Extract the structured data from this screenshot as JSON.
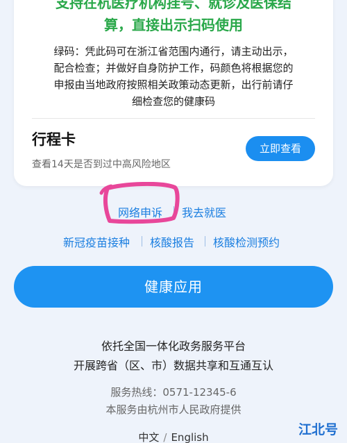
{
  "card": {
    "notice_line1": "支持在杭医疗机构挂号、就诊及医保结",
    "notice_line2": "算，直接出示扫码使用",
    "desc_lines": [
      "绿码：凭此码可在浙江省范围内通行，请主动出示，",
      "配合检查；并做好自身防护工作，码颜色将根据您的",
      "申报由当地政府按照相关政策动态更新，出行前请仔",
      "细检查您的健康码"
    ],
    "trip_title": "行程卡",
    "trip_subtitle": "查看14天是否到过中高风险地区",
    "trip_button": "立即查看"
  },
  "links_row1": {
    "appeal": "网络申诉",
    "see_doctor": "我去就医"
  },
  "links_row2": {
    "vaccine": "新冠疫苗接种",
    "report": "核酸报告",
    "appointment": "核酸检测预约"
  },
  "health_app_button": "健康应用",
  "footer": {
    "line1": "依托全国一体化政务服务平台",
    "line2": "开展跨省（区、市）数据共享和互通互认",
    "hotline": "服务热线：0571-12345-6",
    "provider": "本服务由杭州市人民政府提供"
  },
  "language": {
    "zh": "中文",
    "separator": "/",
    "en": "English"
  },
  "watermark": "江北号",
  "colors": {
    "notice_green": "#2aa84a",
    "link_blue": "#1a7ee0",
    "button_blue": "#1e93f2",
    "highlight_pink": "#e8479a"
  }
}
